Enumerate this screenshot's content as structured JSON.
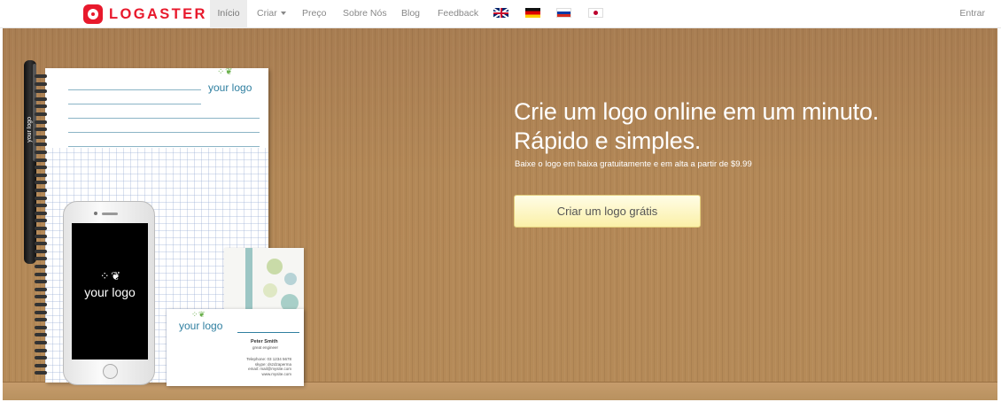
{
  "brand": {
    "name": "LOGASTER",
    "color": "#e8192c"
  },
  "nav": {
    "items": [
      {
        "label": "Início",
        "active": true
      },
      {
        "label": "Criar"
      },
      {
        "label": "Preço"
      },
      {
        "label": "Sobre Nós"
      },
      {
        "label": "Blog"
      },
      {
        "label": "Feedback"
      }
    ],
    "flags": [
      "flag-uk-icon",
      "flag-de-icon",
      "flag-ru-icon",
      "flag-jp-icon"
    ],
    "login": "Entrar"
  },
  "hero": {
    "headline_line1": "Crie um logo online em um minuto.",
    "headline_line2": "Rápido e simples.",
    "subline": "Baixe o logo em baixa gratuitamente e em alta a partir de $9.99",
    "cta": "Criar um logo grátis"
  },
  "mockup": {
    "pad_logo": "your logo",
    "pen_logo": "your logo",
    "phone_logo": "your logo",
    "card_logo": "your logo",
    "card_name": "Peter Smith",
    "card_role": "great engineer",
    "card_info": [
      "Telephone: 03 1234 5678",
      "skype: dszdzaperma",
      "email: mail@mysite.com",
      "www.mysite.com"
    ]
  }
}
